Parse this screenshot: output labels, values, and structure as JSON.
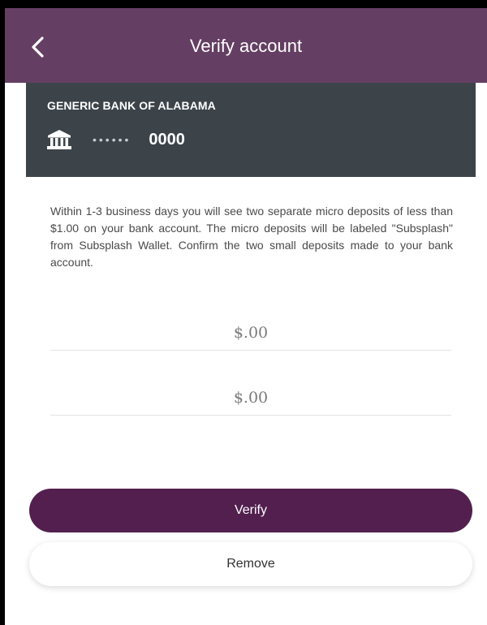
{
  "header": {
    "title": "Verify account",
    "back_icon": "chevron-left-icon"
  },
  "bank": {
    "name": "GENERIC BANK OF ALABAMA",
    "icon": "bank-icon",
    "masked_digits": "••••••",
    "last4": "0000"
  },
  "instructions": "Within 1-3 business days you will see two separate micro deposits of less than $1.00 on your bank account. The micro deposits will be labeled \"Subsplash\" from Subsplash Wallet. Confirm the two small deposits made to your bank account.",
  "deposits": {
    "amount1_placeholder": "$.00",
    "amount2_placeholder": "$.00"
  },
  "actions": {
    "verify_label": "Verify",
    "remove_label": "Remove"
  },
  "colors": {
    "header_bg": "#653f63",
    "card_bg": "#3c444a",
    "primary": "#521f4f"
  }
}
